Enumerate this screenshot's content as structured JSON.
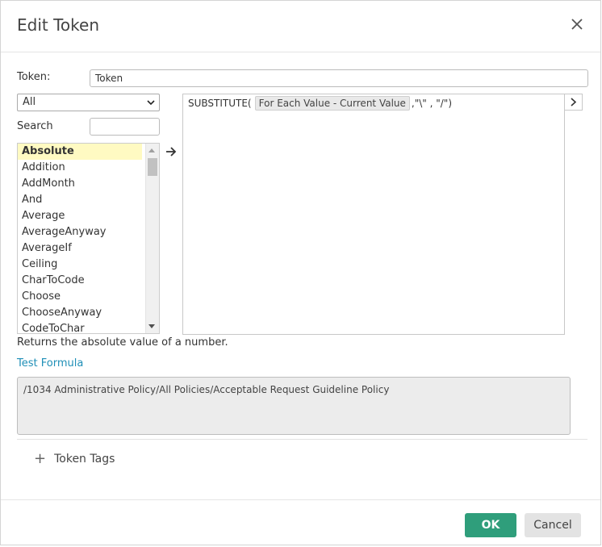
{
  "dialog": {
    "title": "Edit Token",
    "close_icon": "close-icon"
  },
  "token": {
    "label": "Token:",
    "value": "Token"
  },
  "category": {
    "selected": "All"
  },
  "search": {
    "label": "Search",
    "value": ""
  },
  "functions": {
    "items": [
      "Absolute",
      "Addition",
      "AddMonth",
      "And",
      "Average",
      "AverageAnyway",
      "AverageIf",
      "Ceiling",
      "CharToCode",
      "Choose",
      "ChooseAnyway",
      "CodeToChar"
    ],
    "selected_index": 0,
    "insert_icon": "arrow-right-icon"
  },
  "formula": {
    "prefix": "SUBSTITUTE(",
    "chip": "For Each Value - Current Value",
    "suffix": ",\"\\\"  , \"/\")",
    "expand_icon": "chevron-right-icon"
  },
  "description": "Returns the absolute value of a number.",
  "test_formula": {
    "link": "Test Formula",
    "result": "/1034 Administrative Policy/All Policies/Acceptable Request Guideline Policy"
  },
  "token_tags": {
    "label": "Token Tags",
    "icon": "plus-icon"
  },
  "footer": {
    "ok_label": "OK",
    "cancel_label": "Cancel"
  },
  "colors": {
    "primary": "#2f9e7b",
    "link": "#1f8fb7",
    "selected_item_bg": "#fffac2"
  }
}
